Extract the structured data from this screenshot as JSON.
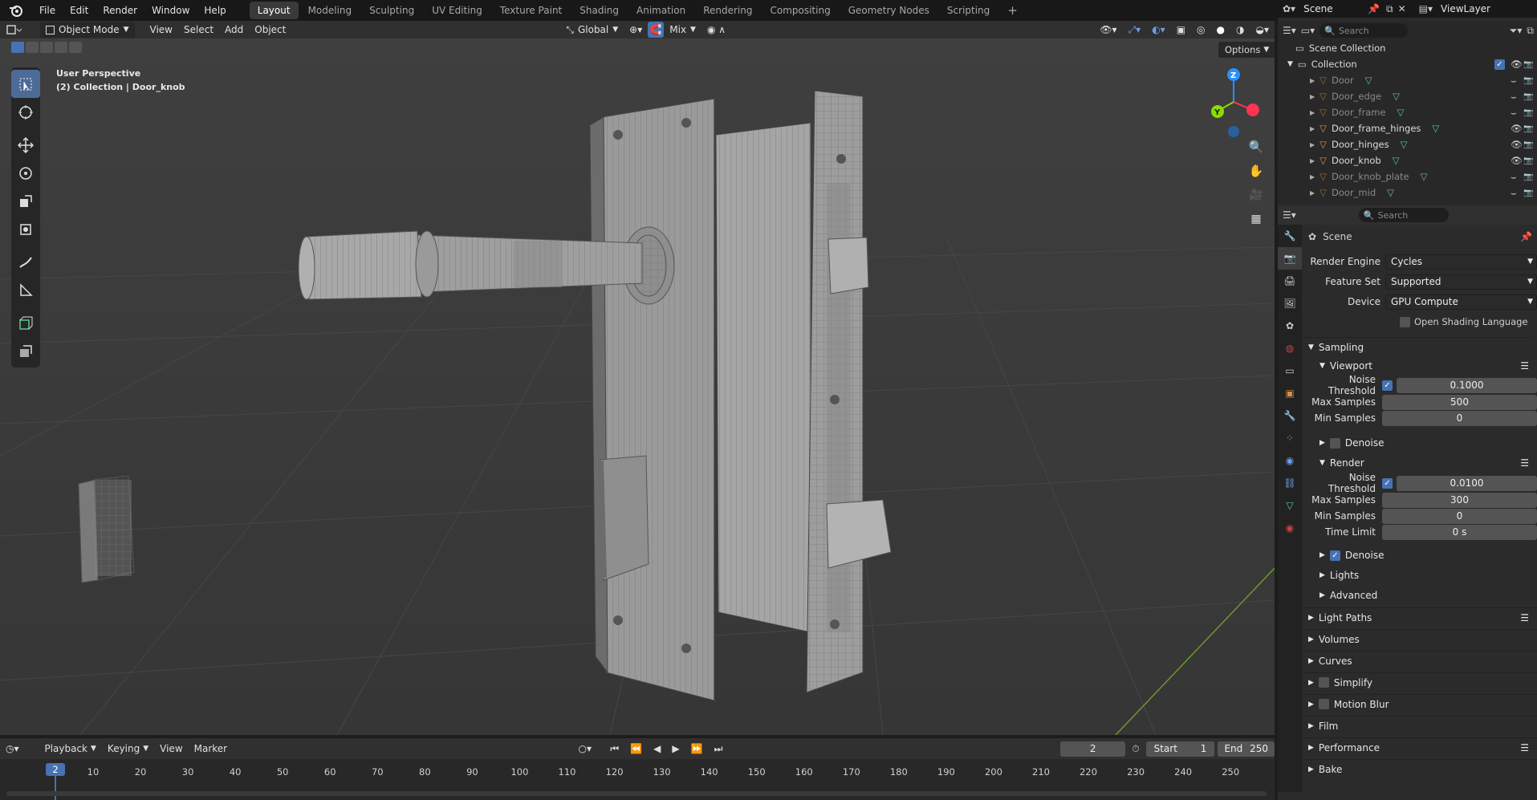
{
  "menu": {
    "file": "File",
    "edit": "Edit",
    "render": "Render",
    "window": "Window",
    "help": "Help"
  },
  "workspaces": [
    "Layout",
    "Modeling",
    "Sculpting",
    "UV Editing",
    "Texture Paint",
    "Shading",
    "Animation",
    "Rendering",
    "Compositing",
    "Geometry Nodes",
    "Scripting"
  ],
  "scene_selector": "Scene",
  "view_layer": "ViewLayer",
  "viewport_header": {
    "mode": "Object Mode",
    "view": "View",
    "select": "Select",
    "add": "Add",
    "object": "Object",
    "orientation": "Global",
    "snap": "Mix",
    "options": "Options"
  },
  "viewport_overlay": {
    "perspective": "User Perspective",
    "context": "(2) Collection | Door_knob"
  },
  "gizmo": {
    "y": "Y",
    "z": "Z"
  },
  "outliner": {
    "search_placeholder": "Search",
    "scene_collection": "Scene Collection",
    "collection": "Collection",
    "items": [
      {
        "name": "Door",
        "visible": false
      },
      {
        "name": "Door_edge",
        "visible": false
      },
      {
        "name": "Door_frame",
        "visible": false
      },
      {
        "name": "Door_frame_hinges",
        "visible": true
      },
      {
        "name": "Door_hinges",
        "visible": true
      },
      {
        "name": "Door_knob",
        "visible": true
      },
      {
        "name": "Door_knob_plate",
        "visible": false
      },
      {
        "name": "Door_mid",
        "visible": false
      }
    ]
  },
  "properties": {
    "search_placeholder": "Search",
    "scene_label": "Scene",
    "render_engine_label": "Render Engine",
    "render_engine": "Cycles",
    "feature_set_label": "Feature Set",
    "feature_set": "Supported",
    "device_label": "Device",
    "device": "GPU Compute",
    "osl_label": "Open Shading Language",
    "sampling": "Sampling",
    "viewport": "Viewport",
    "noise_threshold_label": "Noise Threshold",
    "viewport_noise_threshold": "0.1000",
    "max_samples_label": "Max Samples",
    "viewport_max_samples": "500",
    "min_samples_label": "Min Samples",
    "viewport_min_samples": "0",
    "denoise_label": "Denoise",
    "render": "Render",
    "render_noise_threshold": "0.0100",
    "render_max_samples": "300",
    "render_min_samples": "0",
    "time_limit_label": "Time Limit",
    "time_limit": "0 s",
    "lights": "Lights",
    "advanced": "Advanced",
    "light_paths": "Light Paths",
    "volumes": "Volumes",
    "curves": "Curves",
    "simplify": "Simplify",
    "motion_blur": "Motion Blur",
    "film": "Film",
    "performance": "Performance",
    "bake": "Bake"
  },
  "timeline": {
    "playback": "Playback",
    "keying": "Keying",
    "view": "View",
    "marker": "Marker",
    "current_frame": "2",
    "start_label": "Start",
    "start": "1",
    "end_label": "End",
    "end": "250",
    "ticks": [
      "10",
      "20",
      "30",
      "40",
      "50",
      "60",
      "70",
      "80",
      "90",
      "100",
      "110",
      "120",
      "130",
      "140",
      "150",
      "160",
      "170",
      "180",
      "190",
      "200",
      "210",
      "220",
      "230",
      "240",
      "250"
    ]
  },
  "colors": {
    "accent": "#4772b3",
    "active_tool": "#4d6b97",
    "object_orange": "#e08d3c",
    "mesh_green": "#5fc58c",
    "axis_x": "#ff3352",
    "axis_y": "#8bdc00",
    "axis_z": "#2890ff"
  }
}
